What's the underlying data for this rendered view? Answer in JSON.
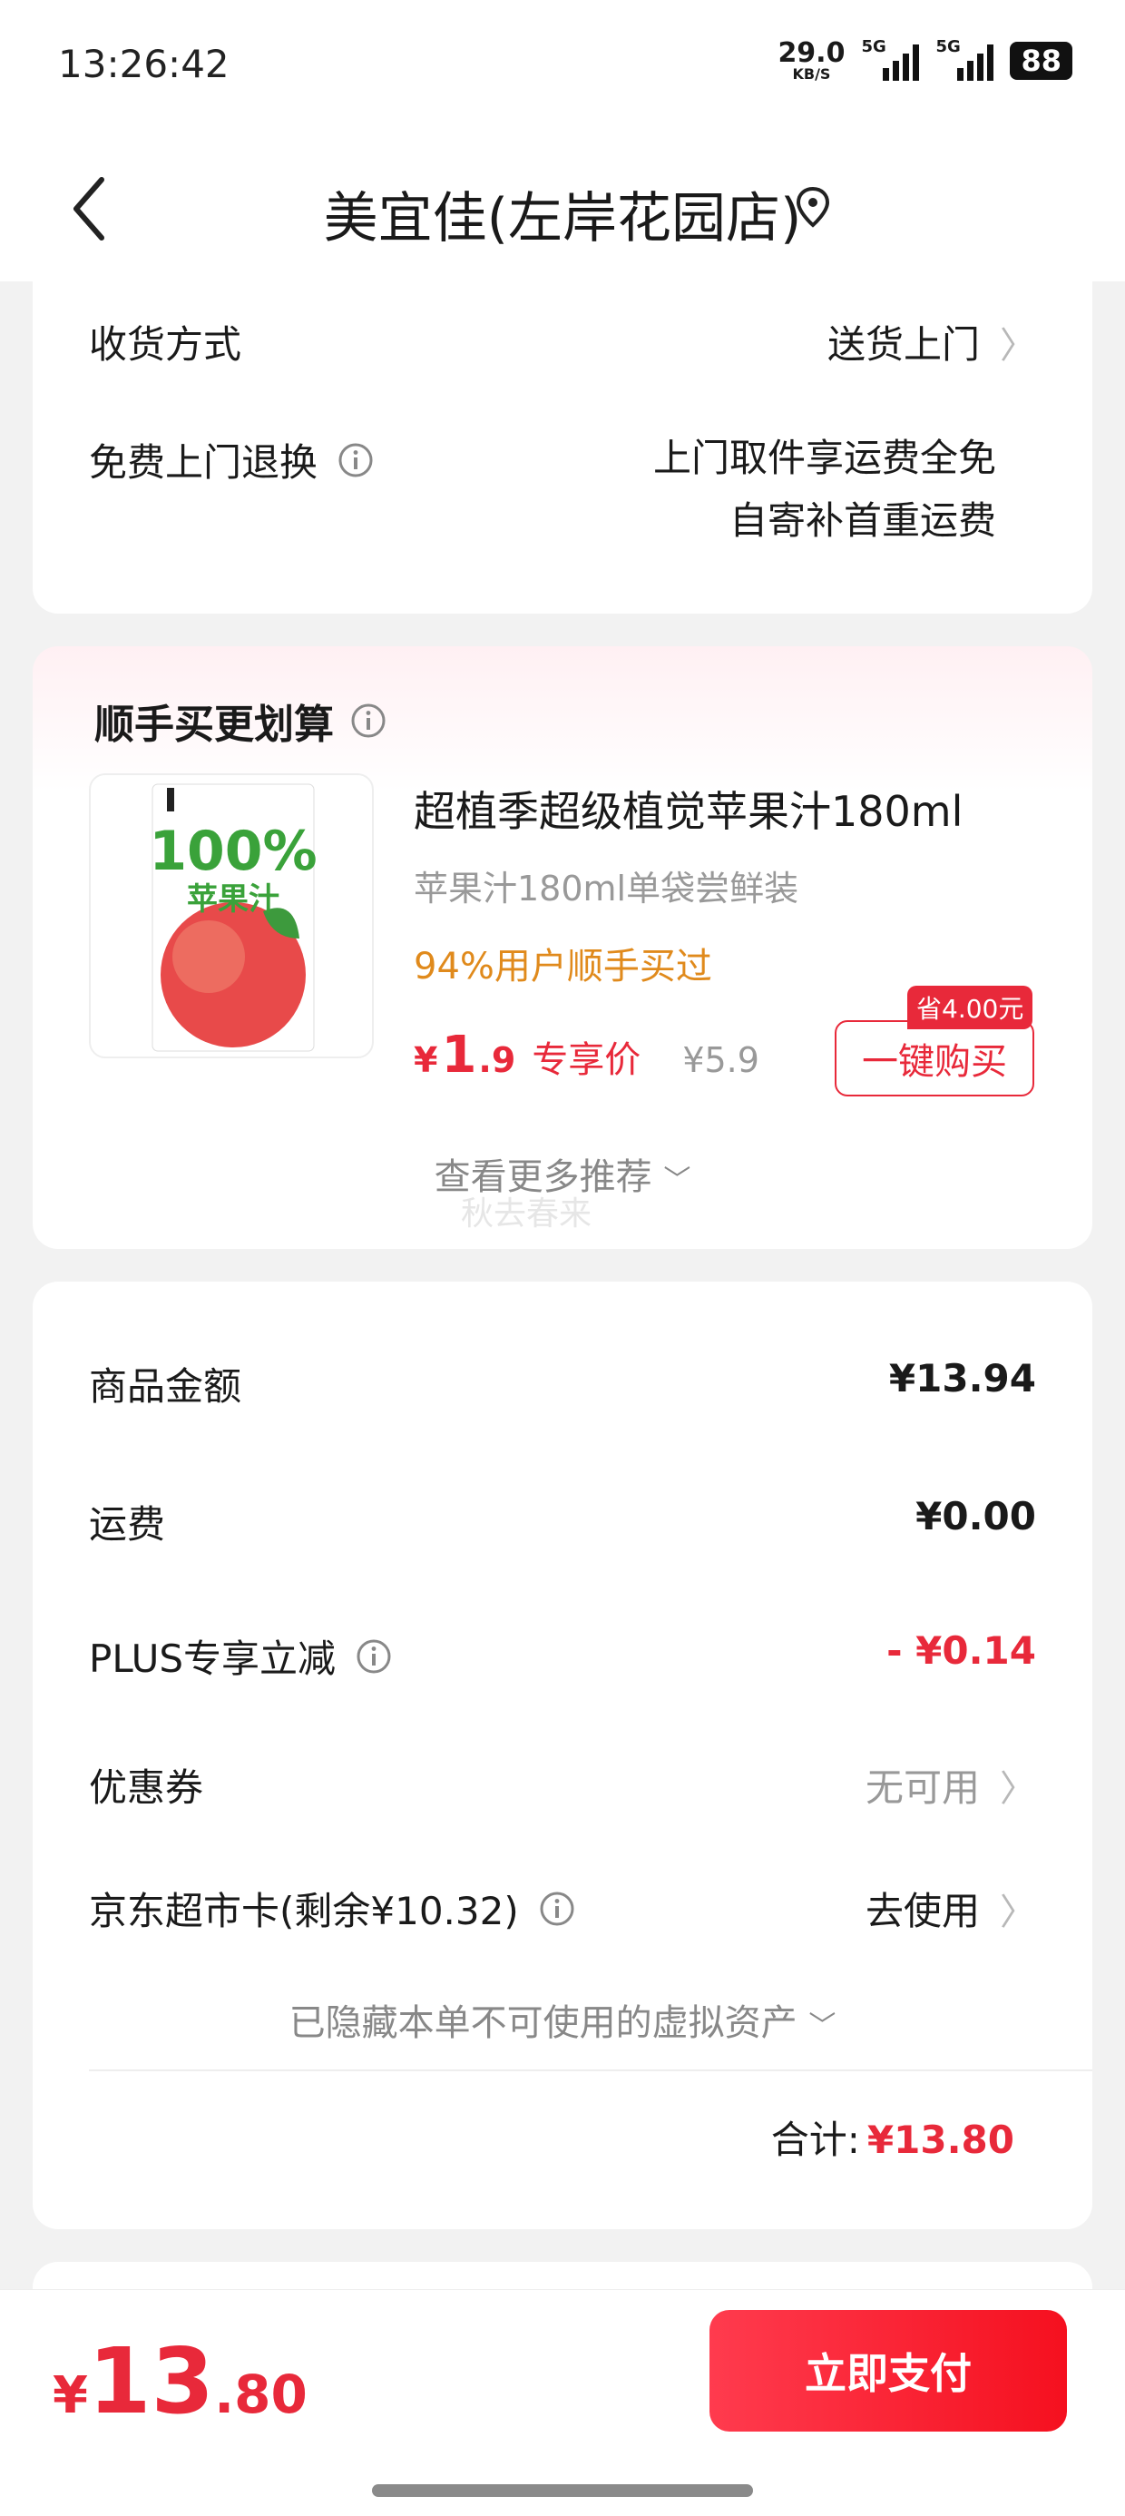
{
  "status_bar": {
    "time": "13:26:42",
    "net_speed": "29.0",
    "net_unit": "KB/S",
    "signal1": "5G",
    "signal2": "5G",
    "battery": "88"
  },
  "nav": {
    "store_name": "美宜佳(左岸花园店)"
  },
  "delivery": {
    "method_label": "收货方式",
    "method_value": "送货上门",
    "return_label": "免费上门退换",
    "return_line1": "上门取件享运费全免",
    "return_line2": "自寄补首重运费"
  },
  "recommend": {
    "title": "顺手买更划算",
    "product_name": "超植季超级植觉苹果汁180ml",
    "product_sub": "苹果汁180ml单袋尝鲜装",
    "product_tip": "94%用户顺手买过",
    "price_symbol": "¥",
    "price_int": "1",
    "price_dec": ".9",
    "price_tag": "专享价",
    "price_orig": "¥5.9",
    "save_badge": "省4.00元",
    "buy_label": "一键购买",
    "more": "查看更多推荐",
    "watermark": "秋去春来",
    "package": {
      "big_text": "100%",
      "sub_text": "苹果汁"
    }
  },
  "summary": {
    "goods_label": "商品金额",
    "goods_value": "¥13.94",
    "shipping_label": "运费",
    "shipping_value": "¥0.00",
    "plus_label": "PLUS专享立减",
    "plus_value": "- ¥0.14",
    "coupon_label": "优惠券",
    "coupon_value": "无可用",
    "card_label": "京东超市卡(剩余¥10.32)",
    "card_value": "去使用",
    "hidden_assets": "已隐藏本单不可使用的虚拟资产",
    "total_label": "合计:",
    "total_value": "¥13.80"
  },
  "bottom": {
    "price_symbol": "¥",
    "price_int": "13",
    "price_dec": ".80",
    "pay_label": "立即支付"
  },
  "colors": {
    "accent": "#e8293a",
    "tip_orange": "#e08a1c"
  }
}
